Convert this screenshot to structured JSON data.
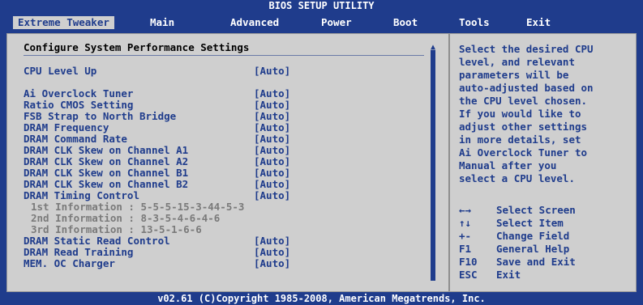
{
  "app": {
    "title": "BIOS SETUP UTILITY"
  },
  "menus": [
    {
      "label": "Extreme Tweaker"
    },
    {
      "label": "Main"
    },
    {
      "label": "Advanced"
    },
    {
      "label": "Power"
    },
    {
      "label": "Boot"
    },
    {
      "label": "Tools"
    },
    {
      "label": "Exit"
    }
  ],
  "main": {
    "section_title": "Configure System Performance Settings",
    "rows": [
      {
        "label": "CPU Level Up",
        "value": "[Auto]"
      },
      {
        "label": "Ai Overclock Tuner",
        "value": "[Auto]"
      },
      {
        "label": "Ratio CMOS Setting",
        "value": "[Auto]"
      },
      {
        "label": "FSB Strap to North Bridge",
        "value": "[Auto]"
      },
      {
        "label": "DRAM Frequency",
        "value": "[Auto]"
      },
      {
        "label": "DRAM Command Rate",
        "value": "[Auto]"
      },
      {
        "label": "DRAM CLK Skew on Channel A1",
        "value": "[Auto]"
      },
      {
        "label": "DRAM CLK Skew on Channel A2",
        "value": "[Auto]"
      },
      {
        "label": "DRAM CLK Skew on Channel B1",
        "value": "[Auto]"
      },
      {
        "label": "DRAM CLK Skew on Channel B2",
        "value": "[Auto]"
      },
      {
        "label": "DRAM Timing Control",
        "value": "[Auto]"
      },
      {
        "label": "DRAM Static Read Control",
        "value": "[Auto]"
      },
      {
        "label": "DRAM Read Training",
        "value": "[Auto]"
      },
      {
        "label": "MEM. OC Charger",
        "value": "[Auto]"
      }
    ],
    "info_lines": [
      "1st Information : 5-5-5-15-3-44-5-3",
      "2nd Information : 8-3-5-4-6-4-6",
      "3rd Information : 13-5-1-6-6"
    ]
  },
  "help": {
    "text": "Select the desired CPU\nlevel, and relevant\nparameters will be\nauto-adjusted based on\nthe CPU level chosen.\nIf you would like to\nadjust other settings\nin more details, set\nAi Overclock Tuner to\nManual after you\nselect a CPU level.",
    "keys": [
      {
        "key": "←→",
        "desc": "Select Screen"
      },
      {
        "key": "↑↓",
        "desc": "Select Item"
      },
      {
        "key": "+-",
        "desc": "Change Field"
      },
      {
        "key": "F1",
        "desc": "General Help"
      },
      {
        "key": "F10",
        "desc": "Save and Exit"
      },
      {
        "key": "ESC",
        "desc": "Exit"
      }
    ]
  },
  "footer": "v02.61 (C)Copyright 1985-2008, American Megatrends, Inc."
}
